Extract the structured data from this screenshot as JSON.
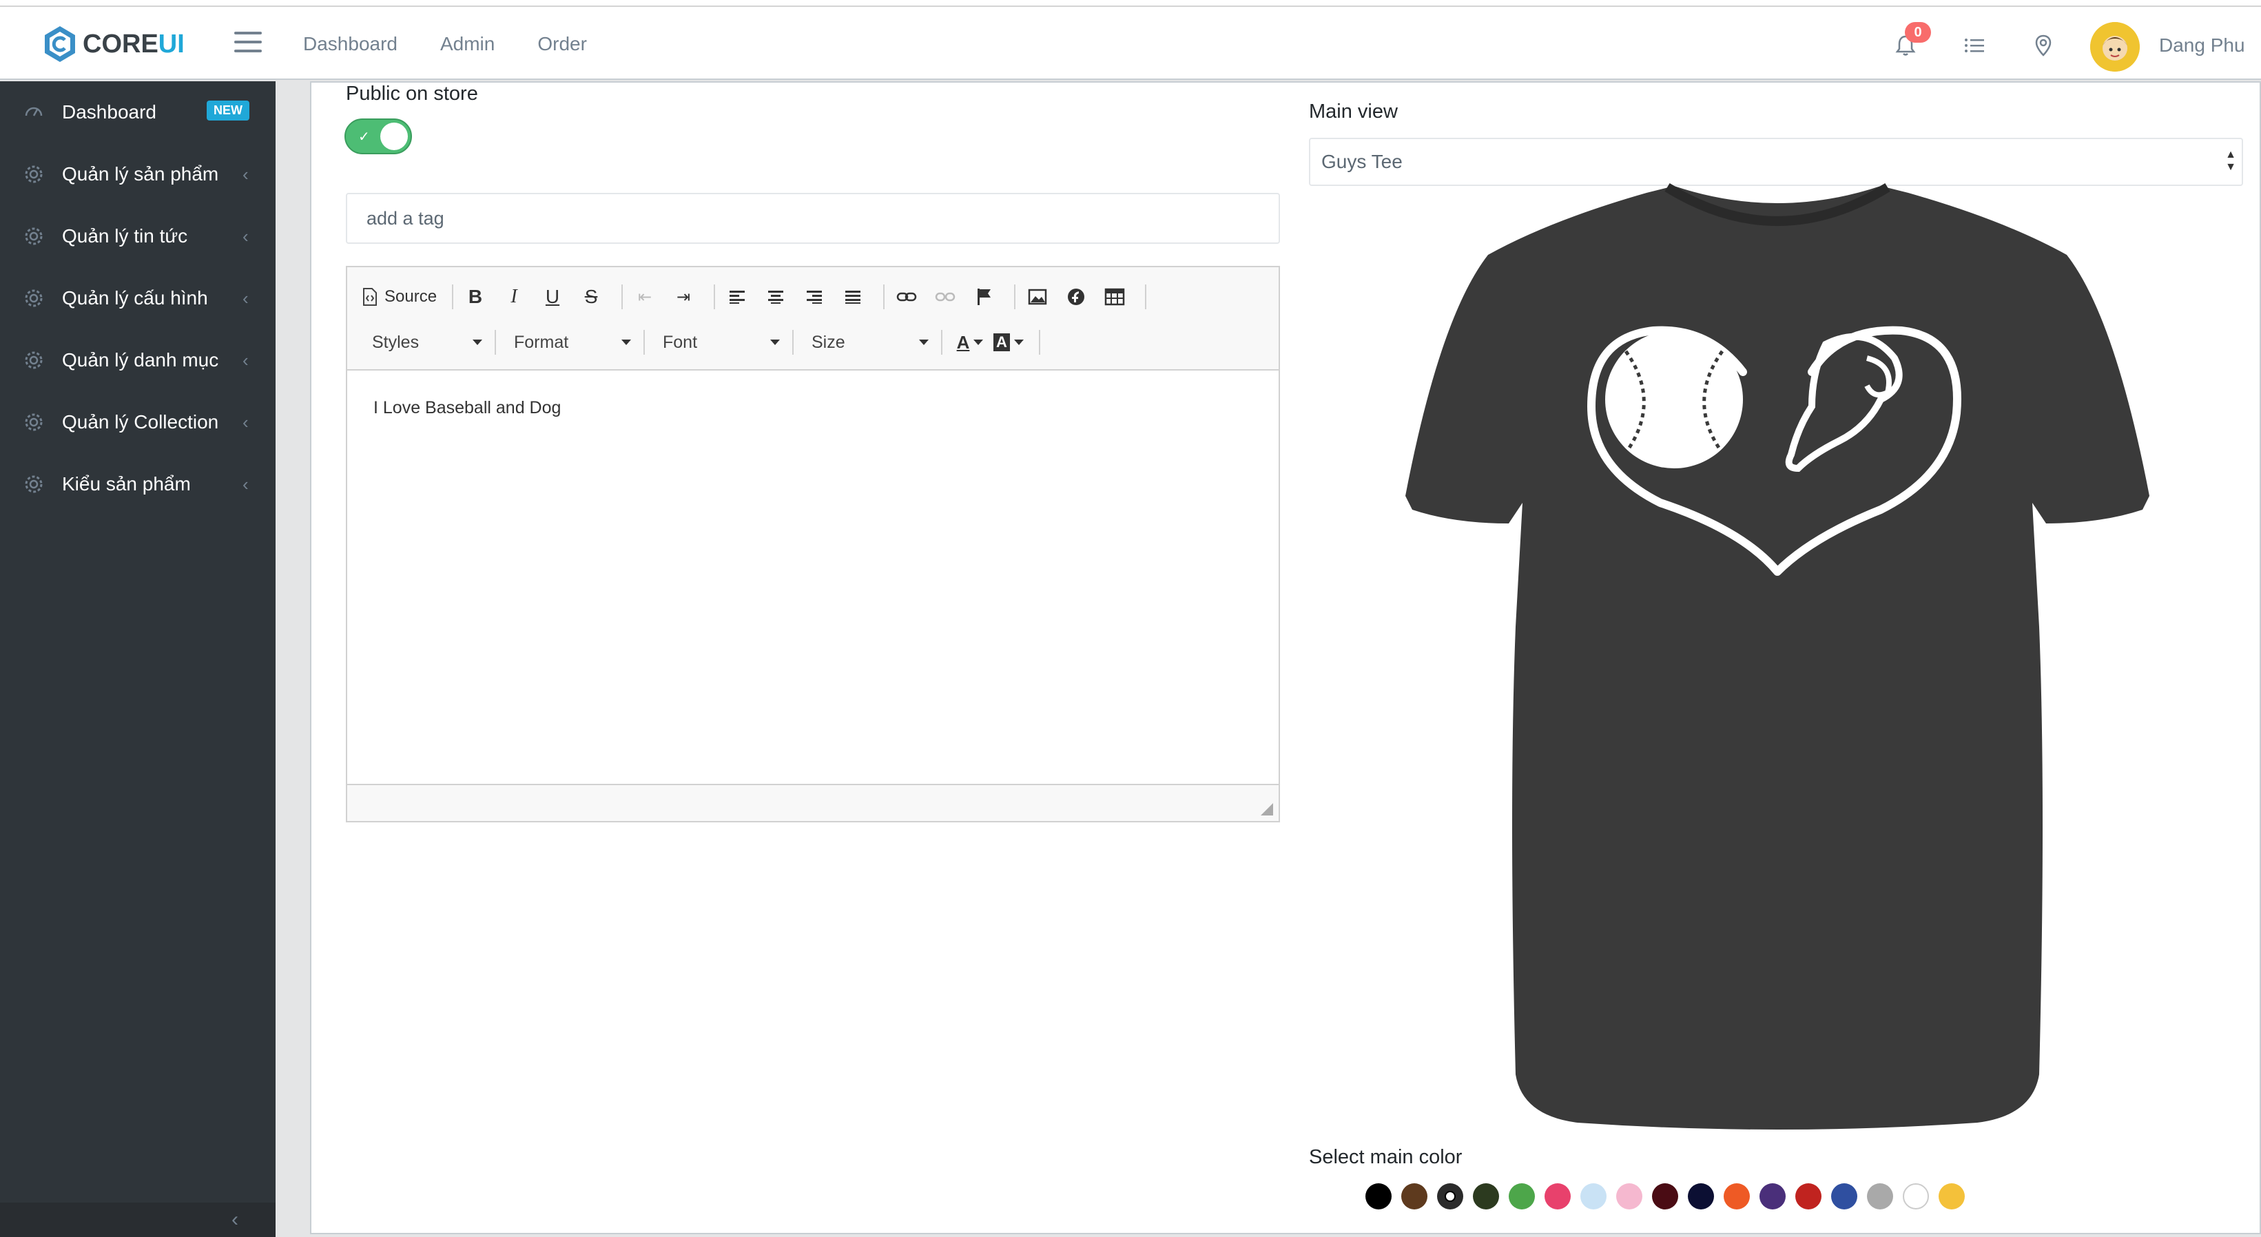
{
  "header": {
    "brand": {
      "core": "CORE",
      "ui": "UI"
    },
    "nav": [
      "Dashboard",
      "Admin",
      "Order"
    ],
    "notification_count": "0",
    "user_name": "Dang Phu"
  },
  "sidebar": {
    "items": [
      {
        "label": "Dashboard",
        "badge": "NEW",
        "icon": "speedometer-icon"
      },
      {
        "label": "Quản lý sản phẩm",
        "icon": "gear-icon"
      },
      {
        "label": "Quản lý tin tức",
        "icon": "gear-icon"
      },
      {
        "label": "Quản lý cấu hình",
        "icon": "gear-icon"
      },
      {
        "label": "Quản lý danh mục",
        "icon": "gear-icon"
      },
      {
        "label": "Quản lý Collection",
        "icon": "gear-icon"
      },
      {
        "label": "Kiểu sản phẩm",
        "icon": "gear-icon"
      }
    ]
  },
  "form": {
    "public_label": "Public on store",
    "public_on": true,
    "tag_placeholder": "add a tag",
    "editor": {
      "source_label": "Source",
      "styles_label": "Styles",
      "format_label": "Format",
      "font_label": "Font",
      "size_label": "Size",
      "content": "I Love Baseball and Dog"
    },
    "main_view_label": "Main view",
    "main_view_value": "Guys Tee",
    "select_color_label": "Select main color",
    "colors": [
      "#000000",
      "#5e3a1e",
      "#2b2b2b",
      "#2c3a1f",
      "#4da64a",
      "#e8416c",
      "#c9e2f5",
      "#f5b8cf",
      "#4a0c14",
      "#0c0f33",
      "#ee5a25",
      "#4a2f7a",
      "#c0231f",
      "#2f4fa0",
      "#a9a9a9",
      "#ffffff",
      "#f4c13a"
    ],
    "selected_color_index": 2
  },
  "product": {
    "shirt_color": "#3a3a3a"
  }
}
